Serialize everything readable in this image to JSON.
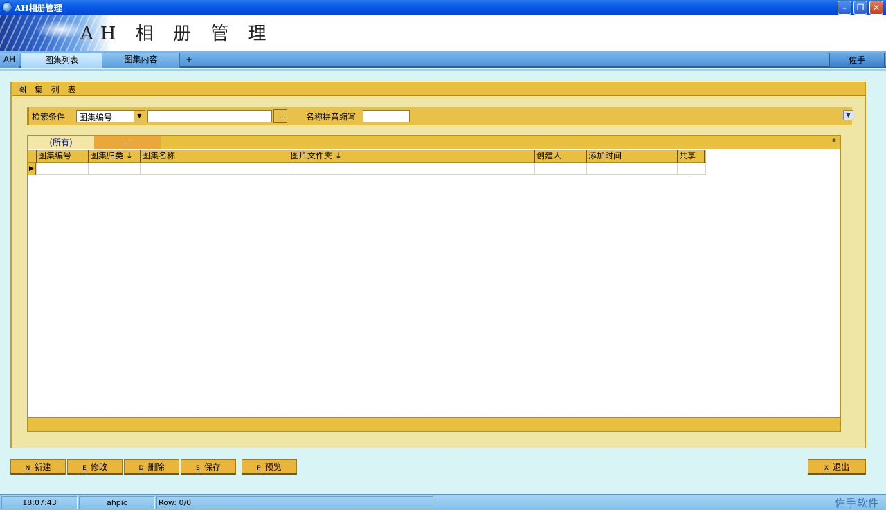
{
  "window": {
    "title": "AH相册管理",
    "controls": {
      "minimize": "–",
      "maximize": "❐",
      "close": "✕"
    }
  },
  "banner": {
    "title": "AH 相 册 管 理"
  },
  "tabs": {
    "ah": "AH",
    "items": [
      "图集列表",
      "图集内容"
    ],
    "add": "+",
    "helper": "佐手"
  },
  "panel": {
    "title": "图 集 列 表",
    "search": {
      "label": "检索条件",
      "field_select": "图集编号",
      "keyword_value": "",
      "ellipsis": "...",
      "pinyin_label": "名称拼音缩写",
      "pinyin_value": ""
    },
    "grid": {
      "filter_tabs": [
        "(所有)",
        "--"
      ],
      "columns": [
        "图集编号",
        "图集归类 ↓",
        "图集名称",
        "图片文件夹 ↓",
        "创建人",
        "添加时间",
        "共享"
      ],
      "rows": [
        {
          "图集编号": "",
          "图集归类": "",
          "图集名称": "",
          "图片文件夹": "",
          "创建人": "",
          "添加时间": "",
          "共享": false
        }
      ]
    }
  },
  "buttons": {
    "new": {
      "key": "N",
      "label": "新建"
    },
    "edit": {
      "key": "E",
      "label": "修改"
    },
    "delete": {
      "key": "D",
      "label": "删除"
    },
    "save": {
      "key": "S",
      "label": "保存"
    },
    "preview": {
      "key": "P",
      "label": "预览"
    },
    "exit": {
      "key": "X",
      "label": "退出"
    }
  },
  "status": {
    "time": "18:07:43",
    "user": "ahpic",
    "rows": "Row: 0/0",
    "brand": "佐手软件"
  },
  "colors": {
    "titlebar": "#0a5ce4",
    "panel_bg": "#efe5a4",
    "gold": "#e9bf40",
    "tab_blue": "#5a9ee0",
    "app_bg": "#d8f4f4"
  }
}
